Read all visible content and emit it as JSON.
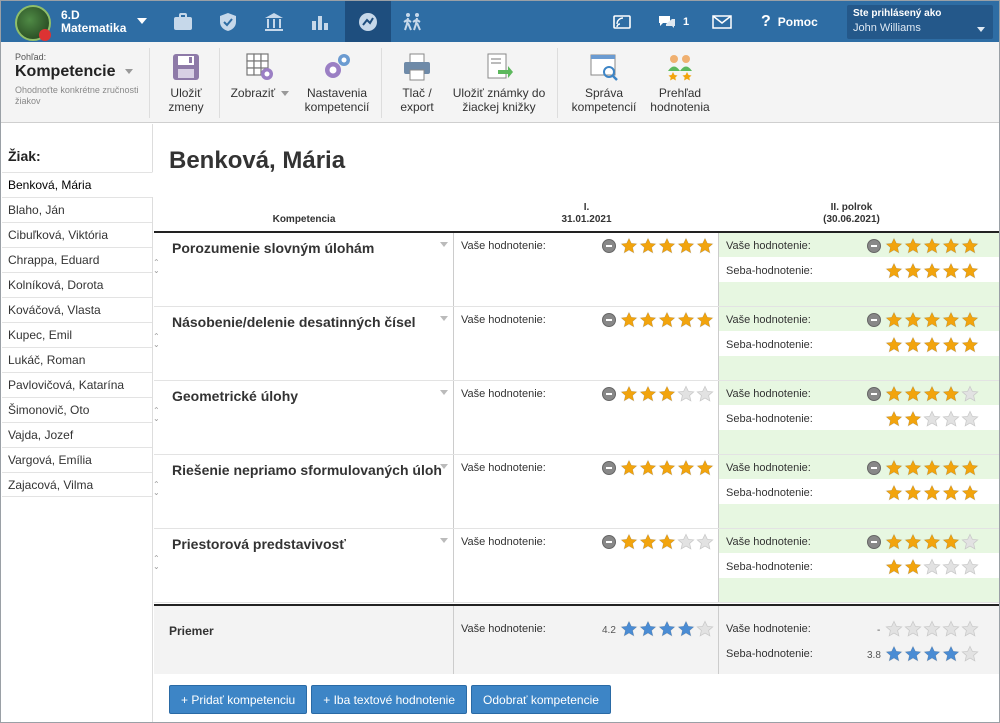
{
  "header": {
    "class_code": "6.D",
    "subject": "Matematika",
    "messages_count": "1",
    "help": "Pomoc",
    "signed_in_label": "Ste prihlásený ako",
    "user": "John Williams"
  },
  "toolbar": {
    "view_label": "Pohľad:",
    "view_title": "Kompetencie",
    "view_sub": "Ohodnoťte konkrétne zručnosti žiakov",
    "save": "Uložiť zmeny",
    "show": "Zobraziť",
    "settings": "Nastavenia kompetencií",
    "print": "Tlač / export",
    "save_grades": "Uložiť známky do žiackej knižky",
    "manage": "Správa kompetencií",
    "overview": "Prehľad hodnotenia"
  },
  "sidebar": {
    "heading": "Žiak:",
    "students": [
      "Benková, Mária",
      "Blaho, Ján",
      "Cibuľková, Viktória",
      "Chrappa, Eduard",
      "Kolníková, Dorota",
      "Kováčová, Vlasta",
      "Kupec, Emil",
      "Lukáč, Roman",
      "Pavlovičová, Katarína",
      "Šimonovič, Oto",
      "Vajda, Jozef",
      "Vargová, Emília",
      "Zajacová, Vilma"
    ]
  },
  "main": {
    "student_name": "Benková, Mária",
    "col_competence": "Kompetencia",
    "col_term1": "I.",
    "col_term1_date": "31.01.2021",
    "col_term2": "II. polrok",
    "col_term2_date": "(30.06.2021)",
    "your_rating": "Vaše hodnotenie:",
    "self_rating": "Seba-hodnotenie:",
    "rows": [
      {
        "name": "Porozumenie slovným úlohám",
        "t1": 5,
        "t2": 5,
        "self": 5
      },
      {
        "name": "Násobenie/delenie desatinných čísel",
        "t1": 5,
        "t2": 5,
        "self": 5
      },
      {
        "name": "Geometrické úlohy",
        "t1": 3,
        "t2": 4,
        "self": 2
      },
      {
        "name": "Riešenie nepriamo sformulovaných úloh",
        "t1": 5,
        "t2": 5,
        "self": 5
      },
      {
        "name": "Priestorová predstavivosť",
        "t1": 3,
        "t2": 4,
        "self": 2
      }
    ],
    "average": {
      "label": "Priemer",
      "t1_value": "4.2",
      "t1_stars": 4,
      "t2_value": "-",
      "t2_stars": 0,
      "self_value": "3.8",
      "self_stars": 4
    },
    "buttons": [
      "+ Pridať kompetenciu",
      "+ Iba textové hodnotenie",
      "Odobrať kompetencie"
    ]
  },
  "colors": {
    "star_gold": "#f2a40d",
    "star_blue": "#4a8cd4",
    "star_empty": "#e2e2e2",
    "term2_bg": "#e7f7e1",
    "topbar": "#2e6da4"
  }
}
